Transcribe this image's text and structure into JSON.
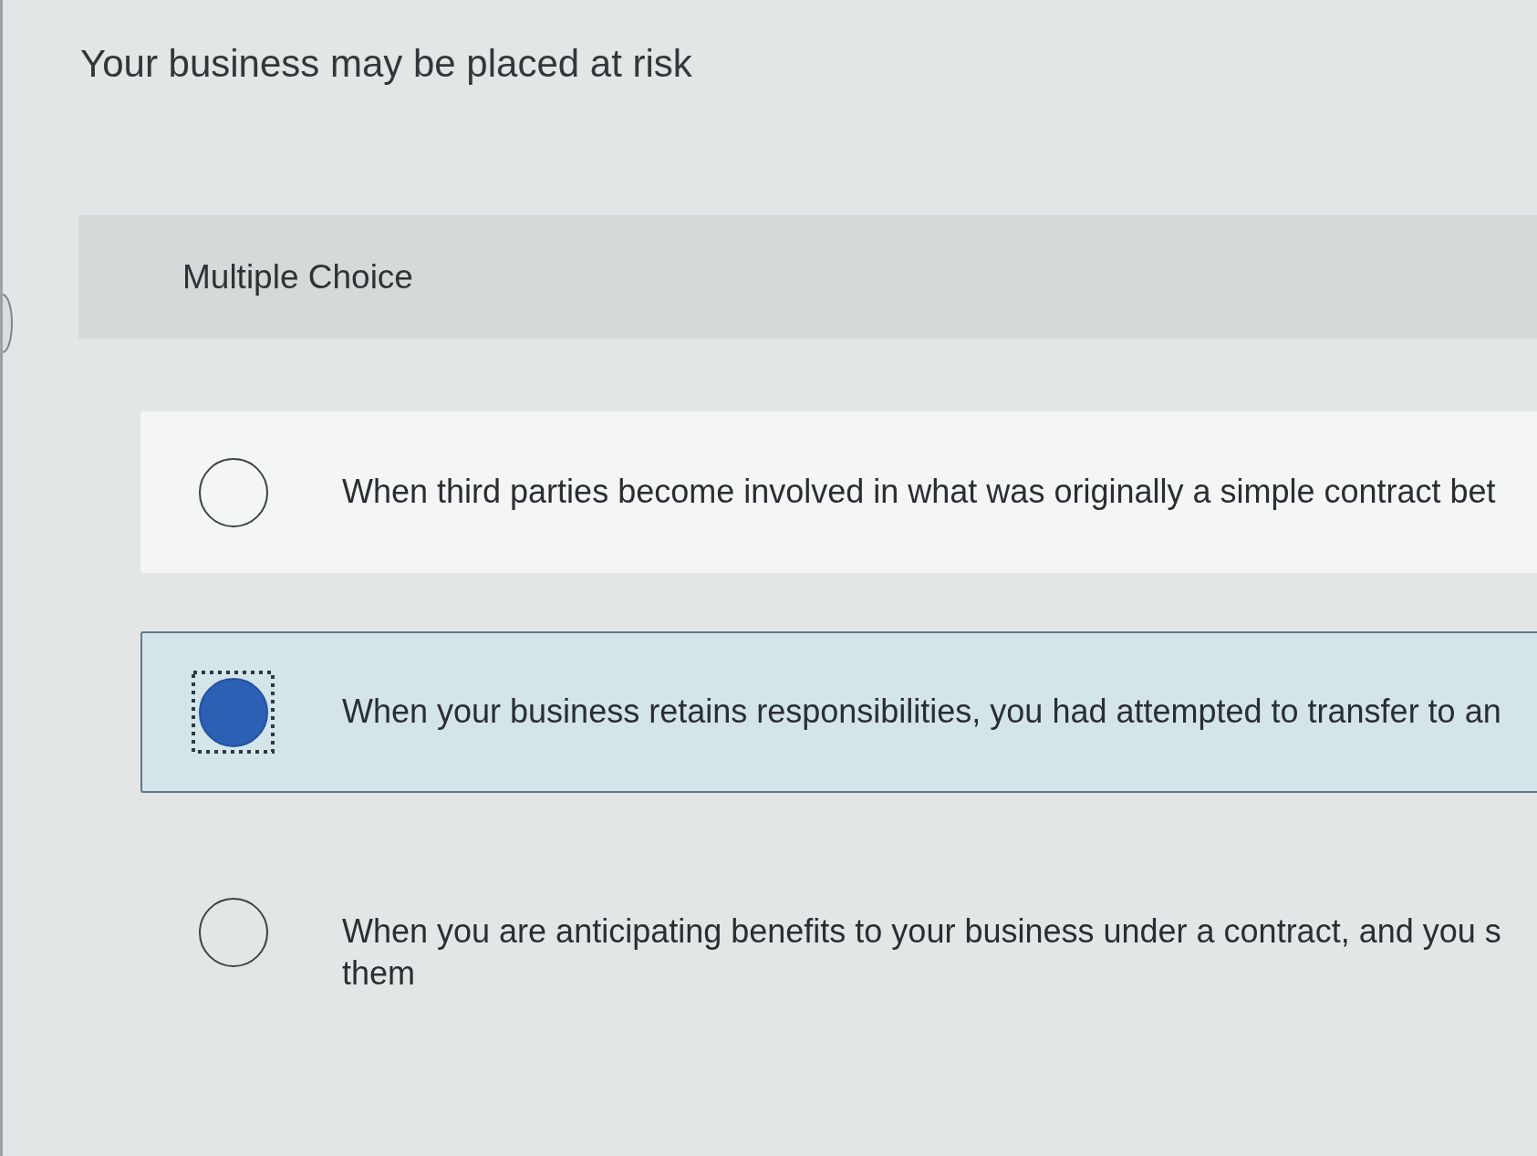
{
  "question": {
    "prompt": "Your business may be placed at risk"
  },
  "header": {
    "label": "Multiple Choice"
  },
  "options": [
    {
      "lines": [
        "When third parties become involved in what was originally a simple contract bet"
      ],
      "selected": false,
      "focused": false,
      "hovered": true
    },
    {
      "lines": [
        "When your business retains responsibilities, you had attempted to transfer to an"
      ],
      "selected": true,
      "focused": true,
      "hovered": false
    },
    {
      "lines": [
        "When you are anticipating benefits to your business under a contract, and you s",
        "them"
      ],
      "selected": false,
      "focused": false,
      "hovered": false
    }
  ]
}
